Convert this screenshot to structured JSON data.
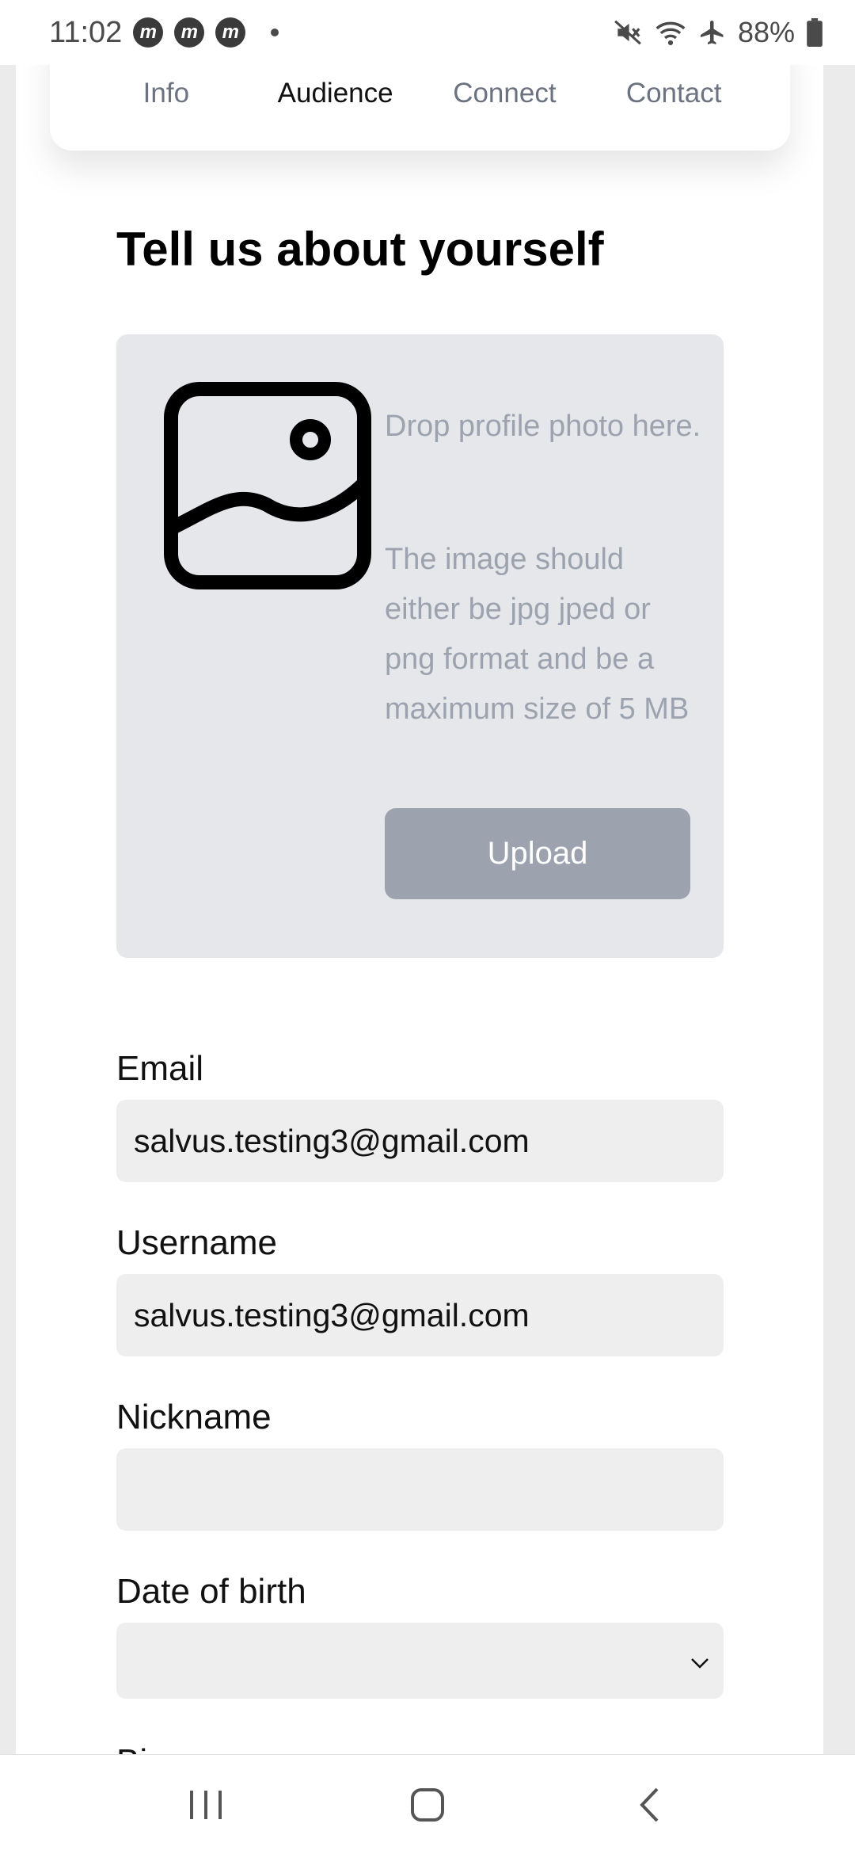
{
  "status_bar": {
    "time": "11:02",
    "notification_icons": [
      "m",
      "m",
      "m"
    ],
    "battery": "88%"
  },
  "tabs": [
    {
      "label": "Info",
      "active": false
    },
    {
      "label": "Audience",
      "active": true
    },
    {
      "label": "Connect",
      "active": false
    },
    {
      "label": "Contact",
      "active": false
    }
  ],
  "page_title": "Tell us about yourself",
  "photo_upload": {
    "drop_text": "Drop profile photo here.",
    "hint": "The image should either be jpg jped or png format and be a maximum size of 5 MB",
    "button_label": "Upload"
  },
  "form": {
    "email": {
      "label": "Email",
      "value": "salvus.testing3@gmail.com"
    },
    "username": {
      "label": "Username",
      "value": "salvus.testing3@gmail.com"
    },
    "nickname": {
      "label": "Nickname",
      "value": ""
    },
    "date_of_birth": {
      "label": "Date of birth",
      "value": ""
    },
    "next_label_partial": "Bi"
  },
  "colors": {
    "dropzone_bg": "#e5e7eb",
    "muted_text": "#9ca3af",
    "input_bg": "#eeeeee"
  }
}
